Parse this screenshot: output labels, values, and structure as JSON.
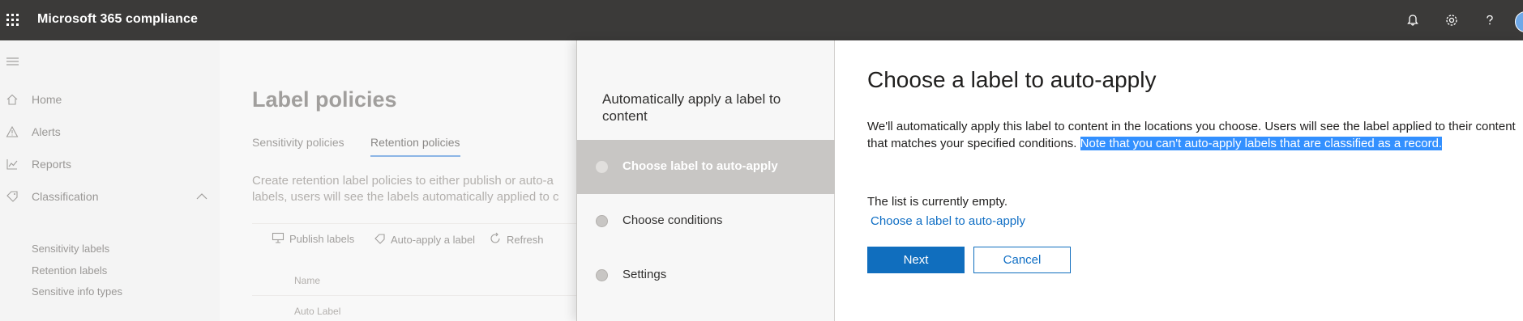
{
  "app": {
    "title": "Microsoft 365 compliance",
    "icons": [
      "waffle-icon",
      "bell-icon",
      "gear-icon",
      "help-icon",
      "avatar"
    ]
  },
  "nav": {
    "items": [
      {
        "label": "Home",
        "icon": "home-icon"
      },
      {
        "label": "Alerts",
        "icon": "alert-icon"
      },
      {
        "label": "Reports",
        "icon": "chart-icon"
      },
      {
        "label": "Classification",
        "icon": "tag-icon",
        "expanded": true
      }
    ],
    "subitems": [
      "Sensitivity labels",
      "Retention labels",
      "Sensitive info types"
    ]
  },
  "page": {
    "title": "Label policies",
    "tabs": [
      {
        "label": "Sensitivity policies",
        "active": false
      },
      {
        "label": "Retention policies",
        "active": true
      }
    ],
    "description_line1": "Create retention label policies to either publish or auto-a",
    "description_line2": "labels, users will see the labels automatically applied to c",
    "toolbar": {
      "publish": "Publish labels",
      "auto_apply": "Auto-apply a label",
      "refresh": "Refresh"
    },
    "table": {
      "column_name": "Name",
      "row": "Auto Label"
    }
  },
  "wizard": {
    "title": "Automatically apply a label to content",
    "steps": [
      {
        "label": "Choose label to auto-apply",
        "active": true
      },
      {
        "label": "Choose conditions",
        "active": false
      },
      {
        "label": "Settings",
        "active": false
      }
    ],
    "heading": "Choose a label to auto-apply",
    "paragraph_normal": "We'll automatically apply this label to content in the locations you choose. Users will see the label applied to their content that matches your specified conditions. ",
    "paragraph_highlighted": "Note that you can't auto-apply labels that are classified as a record.",
    "empty_text": "The list is currently empty.",
    "link_text": "Choose a label to auto-apply",
    "next_label": "Next",
    "cancel_label": "Cancel"
  },
  "colors": {
    "topbar": "#3b3a39",
    "accent": "#106ebe",
    "active_step": "#c8c6c4",
    "highlight": "#3390ff"
  }
}
